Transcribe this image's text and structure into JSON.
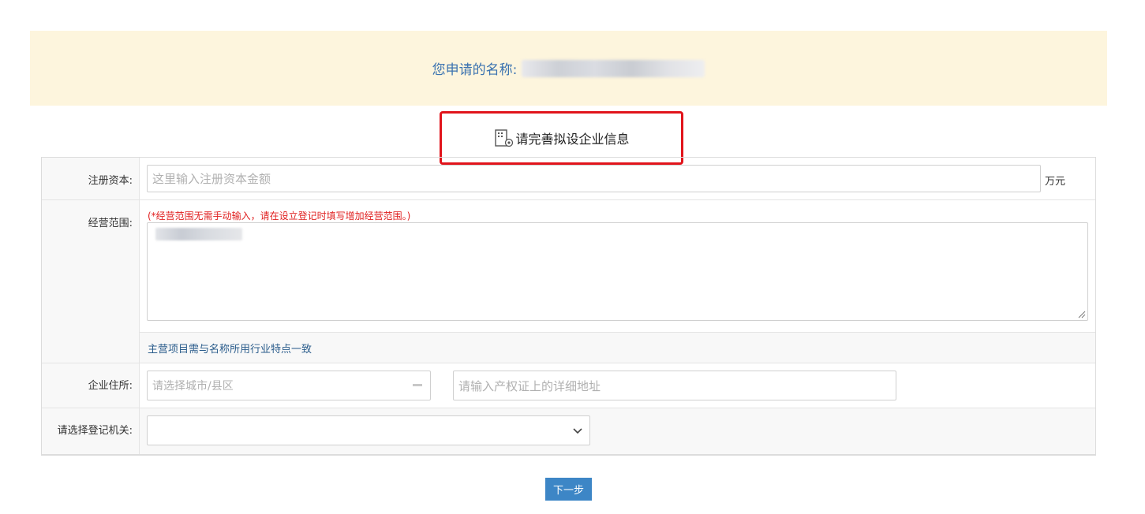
{
  "banner": {
    "label": "您申请的名称:"
  },
  "section": {
    "title": "请完善拟设企业信息"
  },
  "fields": {
    "capital": {
      "label": "注册资本:",
      "placeholder": "这里输入注册资本金额",
      "unit": "万元"
    },
    "scope": {
      "label": "经营范围:",
      "note": "(*经营范围无需手动输入，请在设立登记时填写增加经营范围。)",
      "hint": "主营项目需与名称所用行业特点一致"
    },
    "address": {
      "label": "企业住所:",
      "city_placeholder": "请选择城市/县区",
      "detail_placeholder": "请输入产权证上的详细地址"
    },
    "authority": {
      "label": "请选择登记机关:",
      "selected": ""
    }
  },
  "actions": {
    "next": "下一步"
  },
  "colors": {
    "accent": "#3d86c6",
    "banner_bg": "#fdf5dd",
    "highlight": "#e1141b",
    "error": "#e02020"
  }
}
